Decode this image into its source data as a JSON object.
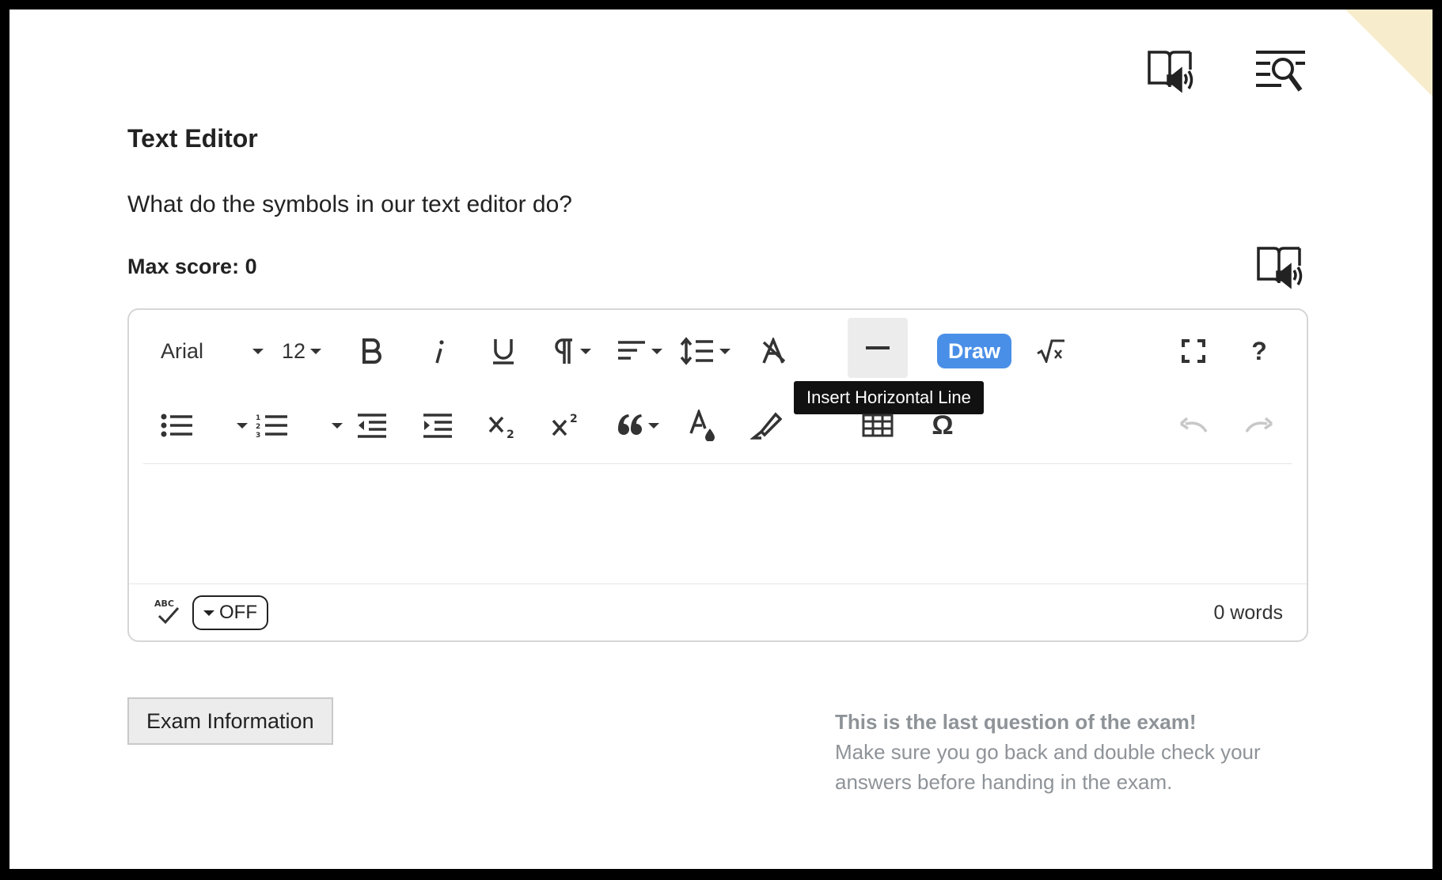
{
  "question": {
    "title": "Text Editor",
    "text": "What do the symbols in our text editor do?",
    "max_score": "Max score: 0"
  },
  "toolbar": {
    "font_family": "Arial",
    "font_size": "12",
    "draw_label": "Draw",
    "help_label": "?",
    "omega_label": "Ω",
    "tooltip": "Insert Horizontal Line"
  },
  "status": {
    "spellcheck_state": "OFF",
    "word_count": "0 words"
  },
  "footer": {
    "exam_info_button": "Exam Information",
    "last_question_title": "This is the last question of the exam!",
    "last_question_text": "Make sure you go back and double check your answers before handing in the exam."
  },
  "colors": {
    "accent": "#4a8fe7",
    "corner": "#f7eccb",
    "muted_text": "#8e9398"
  }
}
